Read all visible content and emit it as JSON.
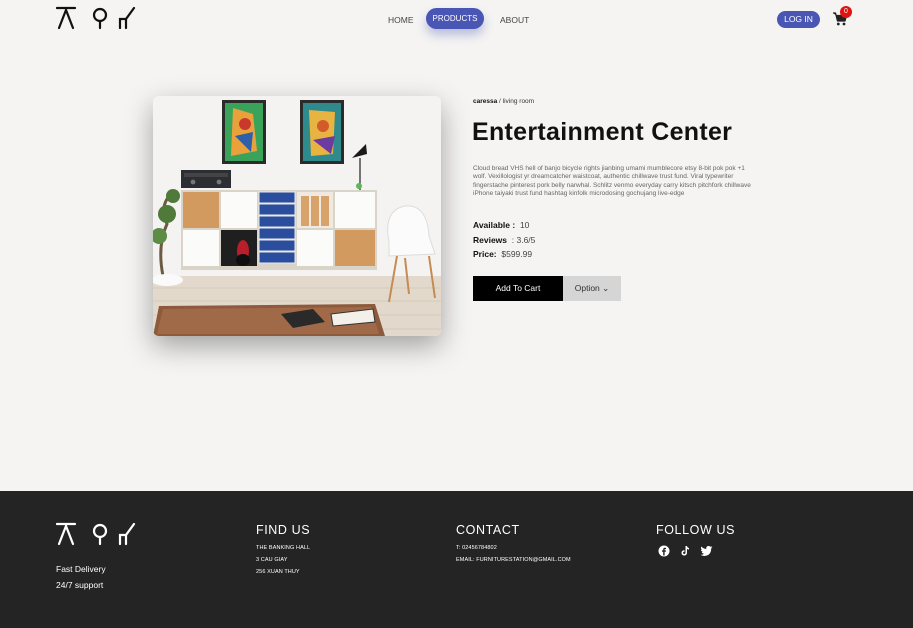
{
  "brand": {
    "logo_icon": "brand-logo-icon"
  },
  "nav": {
    "home": "HOME",
    "products": "PRODUCTS",
    "about": "ABOUT"
  },
  "header": {
    "login_label": "LOG IN",
    "cart_icon": "cart-icon",
    "cart_count": "0"
  },
  "breadcrumb": {
    "company": "caressa",
    "separator": " / ",
    "category": "living room"
  },
  "product": {
    "title": "Entertainment Center",
    "description": "Cloud bread VHS hell of banjo bicycle rights jianbing umami mumblecore etsy 8-bit pok pok +1 wolf. Vexillologist yr dreamcatcher waistcoat, authentic chillwave trust fund. Viral typewriter fingerstache pinterest pork belly narwhal. Schlitz venmo everyday carry kitsch pitchfork chillwave iPhone taiyaki trust fund hashtag kinfolk microdosing gochujang live-edge",
    "available_label": "Available :",
    "available_value": "10",
    "reviews_label": "Reviews",
    "reviews_value": ": 3.6/5",
    "price_label": "Price:",
    "price_value": "$599.99",
    "add_to_cart": "Add To Cart",
    "option": "Option ⌄"
  },
  "footer": {
    "tagline1": "Fast Delivery",
    "tagline2": "24/7 support",
    "find_us": {
      "title": "FIND US",
      "lines": [
        "THE BANKING HALL",
        "3 CAU GIAY",
        "256 XUAN THUY"
      ]
    },
    "contact": {
      "title": "CONTACT",
      "phone": "T: 02456784802",
      "email": "EMAIL: FURNITURESTATION@GMAIL.COM"
    },
    "follow": {
      "title": "FOLLOW US",
      "icons": [
        "facebook-icon",
        "tiktok-icon",
        "twitter-icon"
      ]
    }
  },
  "colors": {
    "accent": "#4a56b3",
    "footer_bg": "#242424",
    "page_bg": "#f5f4f3",
    "badge": "#e01313"
  }
}
